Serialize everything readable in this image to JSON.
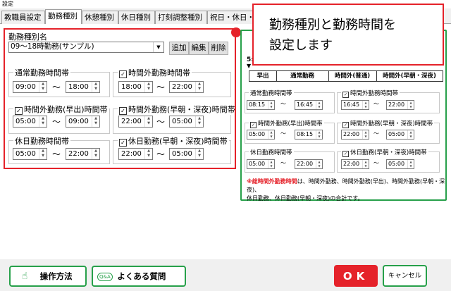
{
  "window": {
    "title": "設定"
  },
  "tabs": [
    "教職員設定",
    "勤務種別",
    "休憩種別",
    "休日種別",
    "打刻調整種別",
    "祝日・休日・出"
  ],
  "active_tab_index": 1,
  "form": {
    "type_name_label": "勤務種別名",
    "type_name_value": "09〜18時勤務(サンプル)",
    "buttons": {
      "add": "追加",
      "edit": "編集",
      "delete": "削除"
    },
    "tilde": "〜",
    "groups": {
      "normal": {
        "title": "通常勤務時間帯",
        "checked": false,
        "from": "09:00",
        "to": "18:00"
      },
      "overtime": {
        "title": "時間外勤務時間帯",
        "checked": true,
        "from": "18:00",
        "to": "22:00"
      },
      "early": {
        "title": "時間外勤務(早出)時間帯",
        "checked": true,
        "from": "05:00",
        "to": "09:00"
      },
      "night": {
        "title": "時間外勤務(早朝・深夜)時間帯",
        "checked": true,
        "from": "22:00",
        "to": "05:00"
      },
      "holiday": {
        "title": "休日勤務時間帯",
        "checked": false,
        "from": "05:00",
        "to": "22:00"
      },
      "holiday_night": {
        "title": "休日勤務(早朝・深夜)時間帯",
        "checked": true,
        "from": "22:00",
        "to": "05:00"
      }
    },
    "check_mark": "✓"
  },
  "callout": {
    "text_line1": "勤務種別と勤務時間を",
    "text_line2": "設定します"
  },
  "preview": {
    "partial_time": "5:",
    "tabs": [
      "早出",
      "通常勤務",
      "時間外(普通)",
      "時間外(早朝・深夜)"
    ],
    "groups": {
      "normal": {
        "title": "通常勤務時間帯",
        "from": "08:15",
        "to": "16:45"
      },
      "overtime": {
        "title": "時間外勤務時間帯",
        "from": "16:45",
        "to": "22:00"
      },
      "early": {
        "title": "時間外勤務(早出)時間帯",
        "from": "05:00",
        "to": "08:15"
      },
      "night": {
        "title": "時間外勤務(早朝・深夜)時間帯",
        "from": "22:00",
        "to": "05:00"
      },
      "holiday": {
        "title": "休日勤務時間帯",
        "from": "05:00",
        "to": "22:00"
      },
      "holiday_night": {
        "title": "休日勤務(早朝・深夜)時間帯",
        "from": "22:00",
        "to": "05:00"
      }
    },
    "note_highlight": "※総時間外勤務時間",
    "note_rest": "は、時間外勤務、時間外勤務(早出)、時間外勤務(早朝・深夜)、",
    "note_line2": "休日勤務、休日勤務(早朝・深夜)の合計です。"
  },
  "footer": {
    "how_to": "操作方法",
    "faq": "よくある質問",
    "faq_icon_text": "Q&A",
    "ok": "OK",
    "cancel": "キャンセル"
  },
  "colors": {
    "accent_red": "#e5222a",
    "accent_green": "#27a04a"
  }
}
